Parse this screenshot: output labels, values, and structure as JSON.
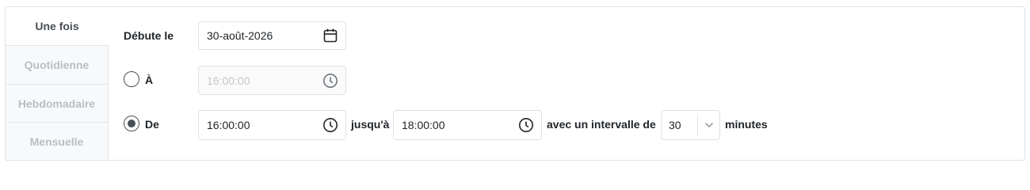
{
  "tabs": [
    {
      "label": "Une fois",
      "active": true
    },
    {
      "label": "Quotidienne",
      "active": false
    },
    {
      "label": "Hebdomadaire",
      "active": false
    },
    {
      "label": "Mensuelle",
      "active": false
    }
  ],
  "start": {
    "label": "Débute le",
    "value": "30-août-2026",
    "icon": "calendar-icon"
  },
  "at_option": {
    "label": "À",
    "selected": false,
    "time": "16:00:00",
    "disabled": true,
    "icon": "clock-icon"
  },
  "range_option": {
    "label": "De",
    "selected": true,
    "from_time": "16:00:00",
    "until_label": "jusqu'à",
    "to_time": "18:00:00",
    "interval_label": "avec un intervalle de",
    "interval_value": "30",
    "unit_label": "minutes"
  },
  "colors": {
    "border": "#dee2e6",
    "text": "#212529",
    "icon": "#495057",
    "disabled_text": "#c3c7cb",
    "inactive_tab_text": "#b9bec4"
  }
}
